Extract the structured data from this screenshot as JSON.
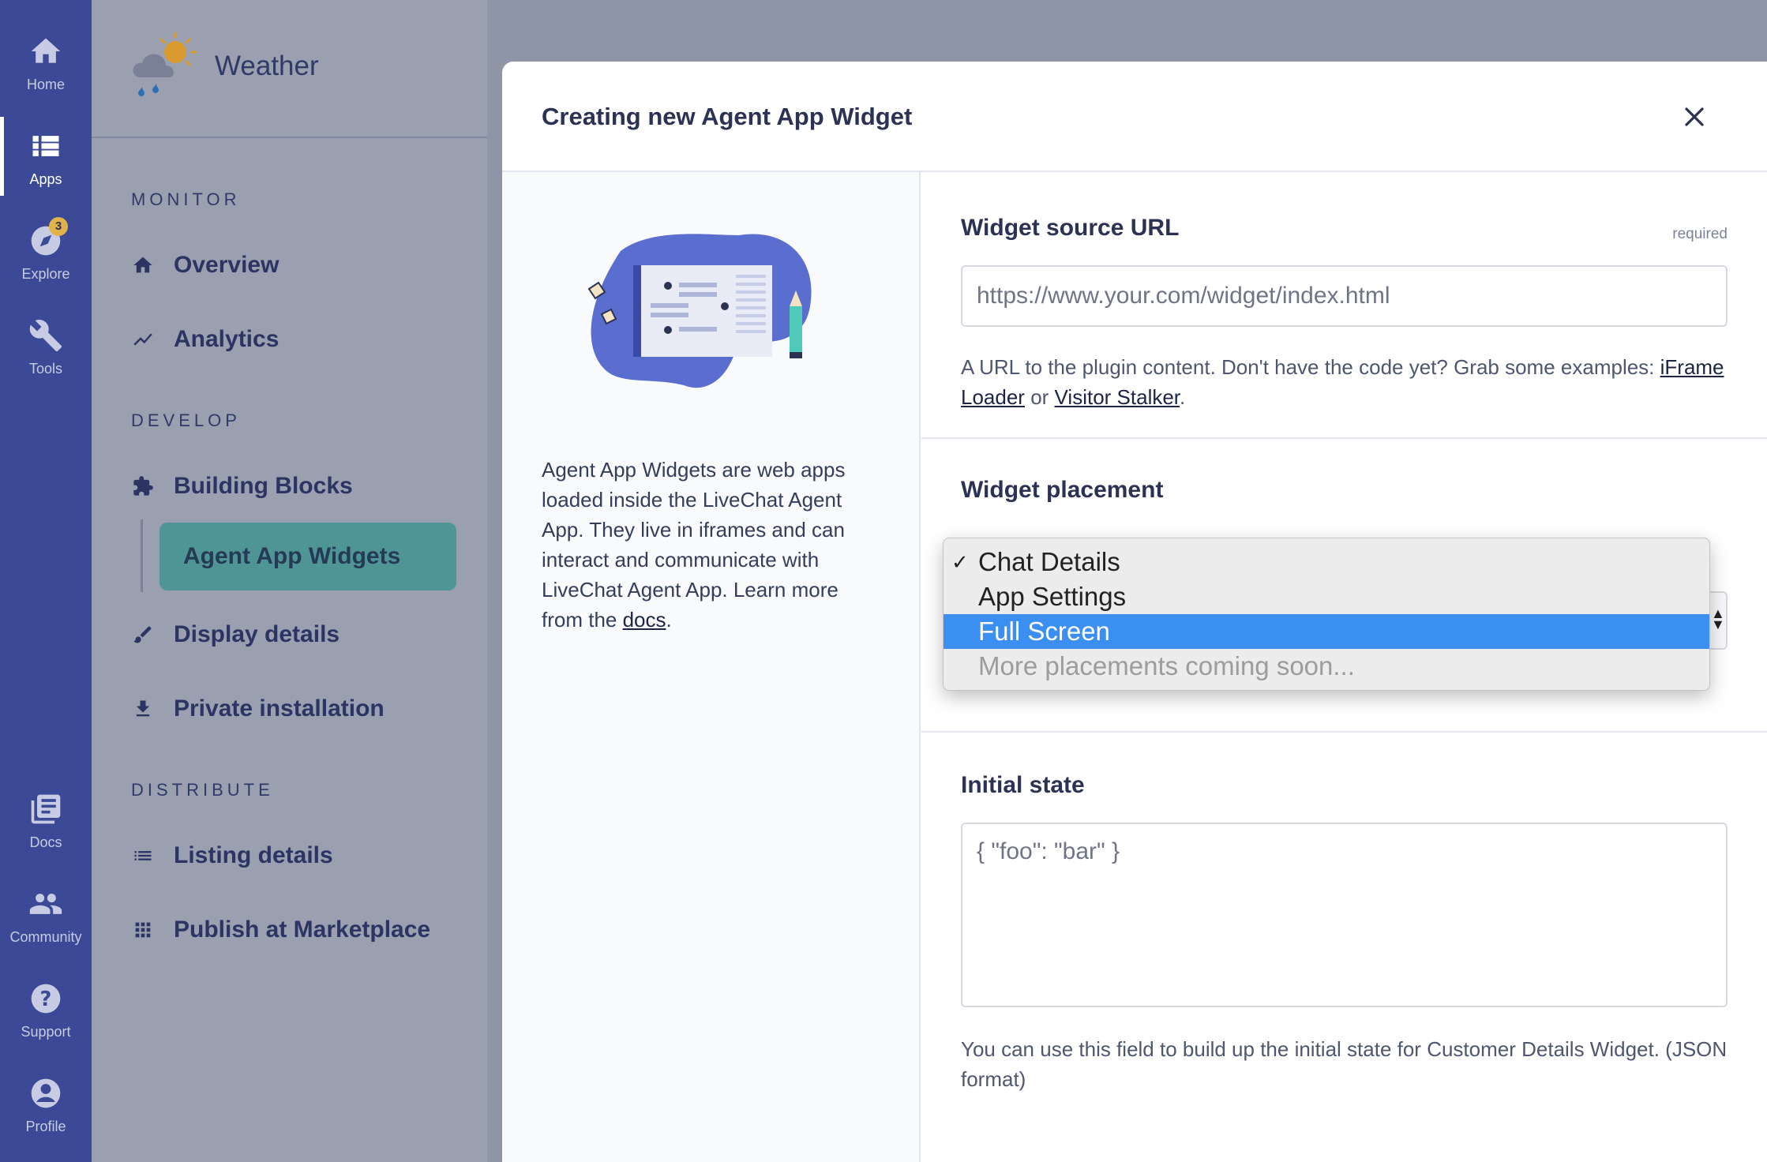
{
  "rail": {
    "items": [
      {
        "label": "Home",
        "icon": "home-icon"
      },
      {
        "label": "Apps",
        "icon": "apps-icon"
      },
      {
        "label": "Explore",
        "icon": "explore-icon",
        "badge": "3"
      },
      {
        "label": "Tools",
        "icon": "wrench-icon"
      },
      {
        "label": "Docs",
        "icon": "docs-icon"
      },
      {
        "label": "Community",
        "icon": "community-icon"
      },
      {
        "label": "Support",
        "icon": "help-icon"
      },
      {
        "label": "Profile",
        "icon": "profile-icon"
      }
    ]
  },
  "sidebar": {
    "app_name": "Weather",
    "monitor_label": "MONITOR",
    "develop_label": "DEVELOP",
    "distribute_label": "DISTRIBUTE",
    "items": {
      "overview": "Overview",
      "analytics": "Analytics",
      "building_blocks": "Building Blocks",
      "agent_app_widgets": "Agent App Widgets",
      "display_details": "Display details",
      "private_installation": "Private installation",
      "listing_details": "Listing details",
      "publish": "Publish at Marketplace"
    }
  },
  "modal": {
    "title": "Creating new Agent App Widget",
    "description": {
      "text": "Agent App Widgets are web apps loaded inside the LiveChat Agent App. They live in iframes and can interact and communicate with LiveChat Agent App. Learn more from the ",
      "link": "docs",
      "end": "."
    },
    "source_url": {
      "label": "Widget source URL",
      "required": "required",
      "placeholder": "https://www.your.com/widget/index.html",
      "help_text": "A URL to the plugin content. Don't have the code yet? Grab some examples: ",
      "link1": "iFrame Loader",
      "or": " or ",
      "link2": "Visitor Stalker",
      "end": "."
    },
    "placement": {
      "label": "Widget placement",
      "options": [
        {
          "label": "Chat Details",
          "checked": true,
          "highlighted": false,
          "disabled": false
        },
        {
          "label": "App Settings",
          "checked": false,
          "highlighted": false,
          "disabled": false
        },
        {
          "label": "Full Screen",
          "checked": false,
          "highlighted": true,
          "disabled": false
        },
        {
          "label": "More placements coming soon...",
          "checked": false,
          "highlighted": false,
          "disabled": true
        }
      ]
    },
    "initial_state": {
      "label": "Initial state",
      "placeholder": "{ \"foo\": \"bar\" }",
      "help_text": "You can use this field to build up the initial state for Customer Details Widget. (JSON format)"
    }
  },
  "colors": {
    "rail_bg": "#3b4996",
    "active_item_bg": "#4f9596",
    "highlight": "#3b8ff0"
  }
}
